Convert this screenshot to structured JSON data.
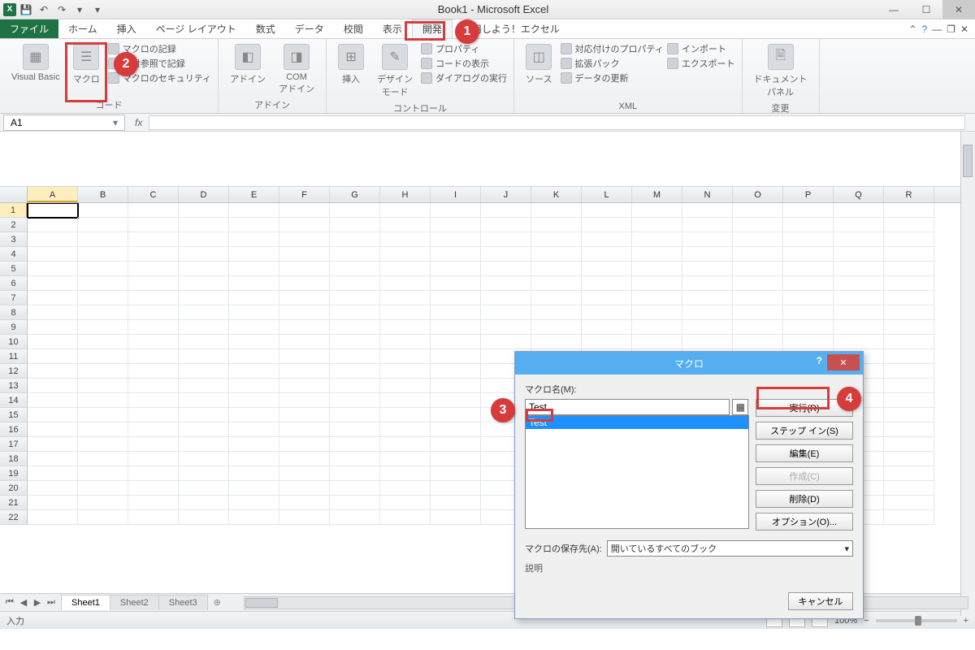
{
  "title": "Book1 - Microsoft Excel",
  "tabs": {
    "file": "ファイル",
    "home": "ホーム",
    "insert": "挿入",
    "pagelayout": "ページ レイアウト",
    "formulas": "数式",
    "data": "データ",
    "review": "校閲",
    "view": "表示",
    "developer": "開発",
    "addin": "活用しよう！エクセル"
  },
  "ribbon": {
    "code": {
      "vb": "Visual Basic",
      "macros": "マクロ",
      "record": "マクロの記録",
      "relative": "相対参照で記録",
      "security": "マクロのセキュリティ",
      "label": "コード"
    },
    "addins": {
      "addin": "アドイン",
      "com": "COM\nアドイン",
      "label": "アドイン"
    },
    "controls": {
      "insert": "挿入",
      "design": "デザイン\nモード",
      "props": "プロパティ",
      "viewcode": "コードの表示",
      "rundlg": "ダイアログの実行",
      "label": "コントロール"
    },
    "xml": {
      "source": "ソース",
      "mapprops": "対応付けのプロパティ",
      "expansion": "拡張パック",
      "refresh": "データの更新",
      "import": "インポート",
      "export": "エクスポート",
      "label": "XML"
    },
    "modify": {
      "panel": "ドキュメント\nパネル",
      "label": "変更"
    }
  },
  "namebox": "A1",
  "columns": [
    "A",
    "B",
    "C",
    "D",
    "E",
    "F",
    "G",
    "H",
    "I",
    "J",
    "K",
    "L",
    "M",
    "N",
    "O",
    "P",
    "Q",
    "R"
  ],
  "rows": [
    1,
    2,
    3,
    4,
    5,
    6,
    7,
    8,
    9,
    10,
    11,
    12,
    13,
    14,
    15,
    16,
    17,
    18,
    19,
    20,
    21,
    22
  ],
  "sheets": {
    "s1": "Sheet1",
    "s2": "Sheet2",
    "s3": "Sheet3"
  },
  "status": {
    "mode": "入力",
    "zoom": "100%"
  },
  "dialog": {
    "title": "マクロ",
    "name_label": "マクロ名(M):",
    "name_value": "Test",
    "list_item": "Test",
    "run": "実行(R)",
    "stepin": "ステップ イン(S)",
    "edit": "編集(E)",
    "create": "作成(C)",
    "delete": "削除(D)",
    "options": "オプション(O)...",
    "storage_label": "マクロの保存先(A):",
    "storage_value": "開いているすべてのブック",
    "desc_label": "説明",
    "cancel": "キャンセル"
  },
  "callouts": {
    "c1": "1",
    "c2": "2",
    "c3": "3",
    "c4": "4"
  }
}
